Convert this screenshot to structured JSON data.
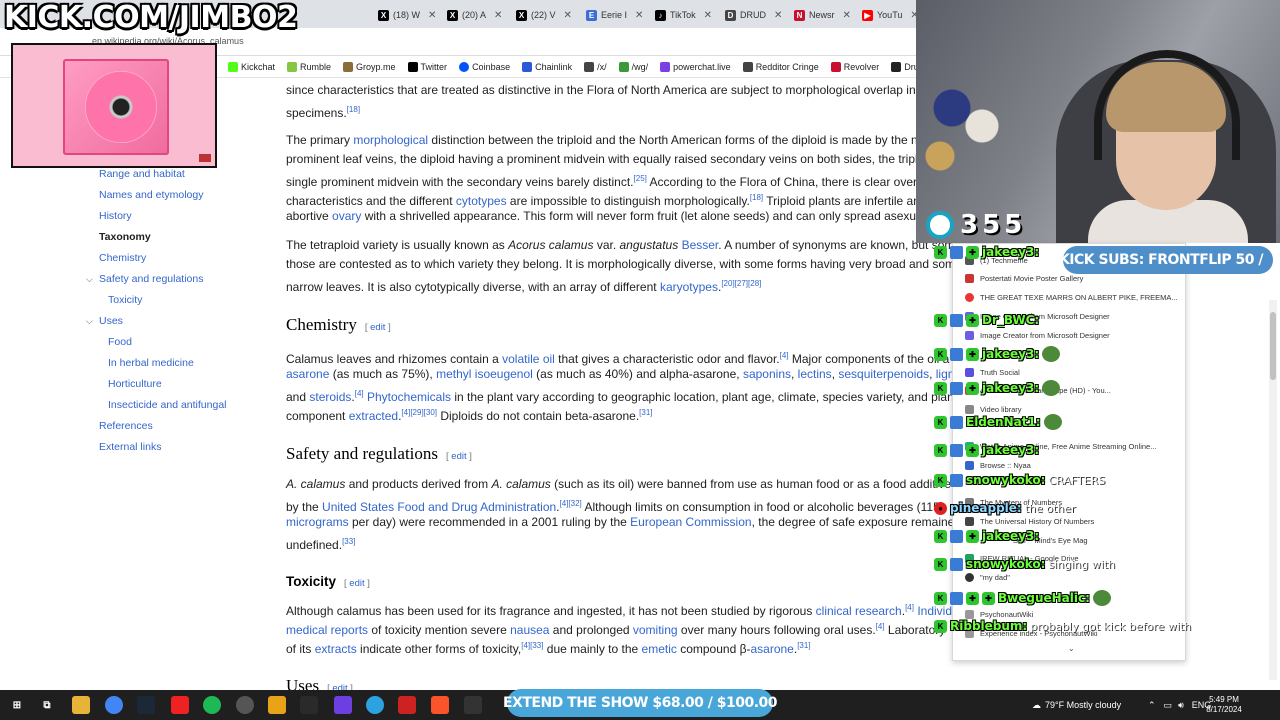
{
  "browser": {
    "tabs": [
      {
        "label": "(18) W",
        "icon": "x-icon",
        "color": "#000000"
      },
      {
        "label": "(20) A",
        "icon": "x-icon",
        "color": "#000000"
      },
      {
        "label": "(22) V",
        "icon": "x-icon",
        "color": "#000000"
      },
      {
        "label": "Eerie I",
        "icon": "news-icon",
        "color": "#3b6fd6"
      },
      {
        "label": "TikTok",
        "icon": "tiktok-icon",
        "color": "#000000"
      },
      {
        "label": "DRUD",
        "icon": "drudge-icon",
        "color": "#444444"
      },
      {
        "label": "Newsr",
        "icon": "newsmax-icon",
        "color": "#c8102e"
      },
      {
        "label": "YouTu",
        "icon": "youtube-icon",
        "color": "#ff0000"
      }
    ],
    "url": "en.wikipedia.org/wiki/Acorus_calamus",
    "bookmarks": [
      {
        "label": "Kickchat",
        "color": "#53fc18"
      },
      {
        "label": "Rumble",
        "color": "#85c742"
      },
      {
        "label": "Groyp.me",
        "color": "#8a6d3b"
      },
      {
        "label": "Twitter",
        "color": "#000000"
      },
      {
        "label": "Coinbase",
        "color": "#0052ff"
      },
      {
        "label": "Chainlink",
        "color": "#2a5ada"
      },
      {
        "label": "/x/",
        "color": "#444444"
      },
      {
        "label": "/wg/",
        "color": "#3a9a3a"
      },
      {
        "label": "powerchat.live",
        "color": "#7b3fe4"
      },
      {
        "label": "Redditor Cringe",
        "color": "#444444"
      },
      {
        "label": "Revolver",
        "color": "#c8102e"
      },
      {
        "label": "Drudge",
        "color": "#222222"
      }
    ]
  },
  "toc": {
    "items": [
      {
        "label": "Range and habitat"
      },
      {
        "label": "Names and etymology"
      },
      {
        "label": "History"
      },
      {
        "label": "Taxonomy"
      },
      {
        "label": "Chemistry"
      },
      {
        "label": "Safety and regulations"
      },
      {
        "label": "Toxicity"
      },
      {
        "label": "Uses"
      },
      {
        "label": "Food"
      },
      {
        "label": "In herbal medicine"
      },
      {
        "label": "Horticulture"
      },
      {
        "label": "Insecticide and antifungal"
      },
      {
        "label": "References"
      },
      {
        "label": "External links"
      }
    ]
  },
  "article": {
    "p1": {
      "l1": "since characteristics that are treated as distinctive in the Flora of North America are subject to morphological overlap in As",
      "l2a": "specimens.",
      "l2ref": "[18]"
    },
    "p2": {
      "l1a": "The primary ",
      "l1link": "morphological",
      "l1b": " distinction between the triploid and the North American forms of the diploid is made by the num",
      "l2": "prominent leaf veins, the diploid having a prominent midvein with equally raised secondary veins on both sides, the triploid",
      "l3a": "single prominent midvein with the secondary veins barely distinct.",
      "l3ref": "[25]",
      "l3b": " According to the Flora of China, there is clear overla",
      "l4a": "characteristics and the different ",
      "l4link": "cytotypes",
      "l4b": " are impossible to distinguish morphologically.",
      "l4ref": "[18]",
      "l4c": " Triploid plants are infertile and",
      "l5a": "abortive ",
      "l5link": "ovary",
      "l5b": " with a shrivelled appearance. This form will never form fruit (let alone seeds) and can only spread asexually"
    },
    "p3": {
      "l1a": "The tetraploid variety is usually known as ",
      "l1i1": "Acorus calamus",
      "l1b": " var. ",
      "l1i2": "angustatus",
      "l1c": " ",
      "l1link": "Besser",
      "l1d": ". A number of synonyms are known, but some",
      "l2": "those are contested as to which variety they belong. It is morphologically diverse, with some forms having very broad and some",
      "l3a": "narrow leaves. It is also cytotypically diverse, with an array of different ",
      "l3link": "karyotypes",
      "l3b": ".",
      "l3ref": "[20][27][28]"
    },
    "chemistry": {
      "heading": "Chemistry",
      "edit": "edit",
      "l1a": "Calamus leaves and rhizomes contain a ",
      "l1link": "volatile oil",
      "l1b": " that gives a characteristic odor and flavor.",
      "l1ref": "[4]",
      "l1c": " Major components of the oil a",
      "l2link1": "asarone",
      "l2a": " (as much as 75%), ",
      "l2link2": "methyl isoeugenol",
      "l2b": " (as much as 40%) and alpha-asarone, ",
      "l2link3": "saponins",
      "l2c": ", ",
      "l2link4": "lectins",
      "l2d": ", ",
      "l2link5": "sesquiterpenoids",
      "l2e": ", ",
      "l2link6": "lignan",
      "l3a": "and ",
      "l3link1": "steroids",
      "l3b": ".",
      "l3ref": "[4]",
      "l3c": " ",
      "l3link2": "Phytochemicals",
      "l3d": " in the plant vary according to geographic location, plant age, climate, species variety, and plan",
      "l4a": "component ",
      "l4link": "extracted",
      "l4b": ".",
      "l4ref": "[4][29][30]",
      "l4c": " Diploids do not contain beta-asarone.",
      "l4ref2": "[31]"
    },
    "safety": {
      "heading": "Safety and regulations",
      "edit": "edit",
      "l1i1": "A. calamus",
      "l1a": " and products derived from ",
      "l1i2": "A. calamus",
      "l1b": " (such as its oil) were banned from use as human food or as a food additive in",
      "l2a": "by the ",
      "l2link": "United States Food and Drug Administration",
      "l2b": ".",
      "l2ref": "[4][32]",
      "l2c": " Although limits on consumption in food or alcoholic beverages (115",
      "l3link1": "micrograms",
      "l3a": " per day) were recommended in a 2001 ruling by the ",
      "l3link2": "European Commission",
      "l3b": ", the degree of safe exposure remained",
      "l4a": "undefined.",
      "l4ref": "[33]"
    },
    "toxicity": {
      "heading": "Toxicity",
      "edit": "edit",
      "l1a": "Although calamus has been used for its fragrance and ingested, it has not been studied by rigorous ",
      "l1link1": "clinical research",
      "l1b": ".",
      "l1ref": "[4]",
      "l1c": " ",
      "l1link2": "Individua",
      "l2link1": "medical reports",
      "l2a": " of toxicity mention severe ",
      "l2link2": "nausea",
      "l2b": " and prolonged ",
      "l2link3": "vomiting",
      "l2c": " over many hours following oral uses.",
      "l2ref": "[4]",
      "l2d": " Laboratory",
      "l3a": "of its ",
      "l3link1": "extracts",
      "l3b": " indicate other forms of toxicity,",
      "l3ref": "[4][33]",
      "l3c": " due mainly to the ",
      "l3link2": "emetic",
      "l3d": " compound β-",
      "l3link3": "asarone",
      "l3e": ".",
      "l3ref2": "[31]"
    },
    "uses": {
      "heading": "Uses",
      "edit": "edit"
    }
  },
  "overlay": {
    "kick_url": "KICK.COM/JIMBO2",
    "viewer_count": "355",
    "subs_banner": "KICK SUBS: FRONTFLIP 50 /",
    "extend_show": "EXTEND THE SHOW $68.00 / $100.00",
    "accent_green": "#53fc18"
  },
  "history": [
    {
      "label": "(1) Techmeme"
    },
    {
      "label": "Postertati Movie Poster Gallery"
    },
    {
      "label": "THE GREAT TEXE MARRS ON ALBERT PIKE, FREEMA..."
    },
    {
      "label": "Image Creator from Microsoft Designer"
    },
    {
      "label": "Image Creator from Microsoft Designer"
    },
    {
      "label": "Truth Social"
    },
    {
      "label": "4K Pokemon Dreamscape (HD) - You..."
    },
    {
      "label": "Video library"
    },
    {
      "label": "Watch Anime Online, Free Anime Streaming Online..."
    },
    {
      "label": "Browse :: Nyaa"
    },
    {
      "label": "The Mystery of Numbers"
    },
    {
      "label": "The Universal History Of Numbers"
    },
    {
      "label": "Self ~ Mind's Eye Mag"
    },
    {
      "label": "IREW RITUAL - Google Drive"
    },
    {
      "label": "\"my dad\""
    },
    {
      "label": "PsychonautWiki"
    },
    {
      "label": "Experience index - PsychonautWiki"
    }
  ],
  "chat": [
    {
      "user": "jakeey3:",
      "msg": ""
    },
    {
      "user": "Dr_BWC:",
      "msg": ""
    },
    {
      "user": "jakeey3:",
      "msg": ""
    },
    {
      "user": "jakeey3:",
      "msg": ""
    },
    {
      "user": "EldenNat1:",
      "msg": ""
    },
    {
      "user": "jakeey3:",
      "msg": ""
    },
    {
      "user": "snowykoko:",
      "msg": "CRAFTERS"
    },
    {
      "user": "pineapple:",
      "msg": "the other"
    },
    {
      "user": "jakeey3:",
      "msg": ""
    },
    {
      "user": "snowykoko:",
      "msg": "singing with"
    },
    {
      "user": "BwegueHalic:",
      "msg": ""
    },
    {
      "user": "Ribblebum:",
      "msg": "probably got kick before with"
    }
  ],
  "taskbar": {
    "weather": "79°F  Mostly cloudy",
    "lang": "ENG",
    "time": "5:49 PM",
    "date": "8/17/2024"
  }
}
